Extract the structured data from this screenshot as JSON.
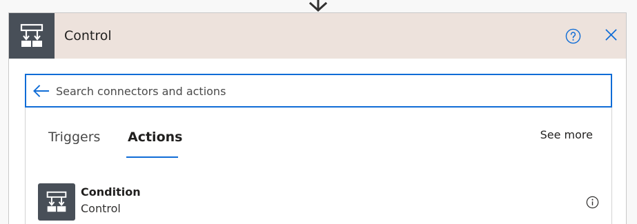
{
  "header": {
    "title": "Control",
    "icon": "control-flow-icon",
    "help_icon": "question-circle-icon",
    "close_icon": "close-icon",
    "background_color": "#ede2dc",
    "icon_tile_color": "#484f58"
  },
  "search": {
    "placeholder": "Search connectors and actions",
    "value": "",
    "back_icon": "back-arrow-icon",
    "border_color": "#0f6cd6"
  },
  "tabs": [
    {
      "label": "Triggers",
      "selected": false
    },
    {
      "label": "Actions",
      "selected": true
    }
  ],
  "see_more_label": "See more",
  "actions": [
    {
      "title": "Condition",
      "subtitle": "Control",
      "icon": "control-flow-icon",
      "info_icon": "info-icon"
    }
  ],
  "accent_color": "#0f6cd6"
}
